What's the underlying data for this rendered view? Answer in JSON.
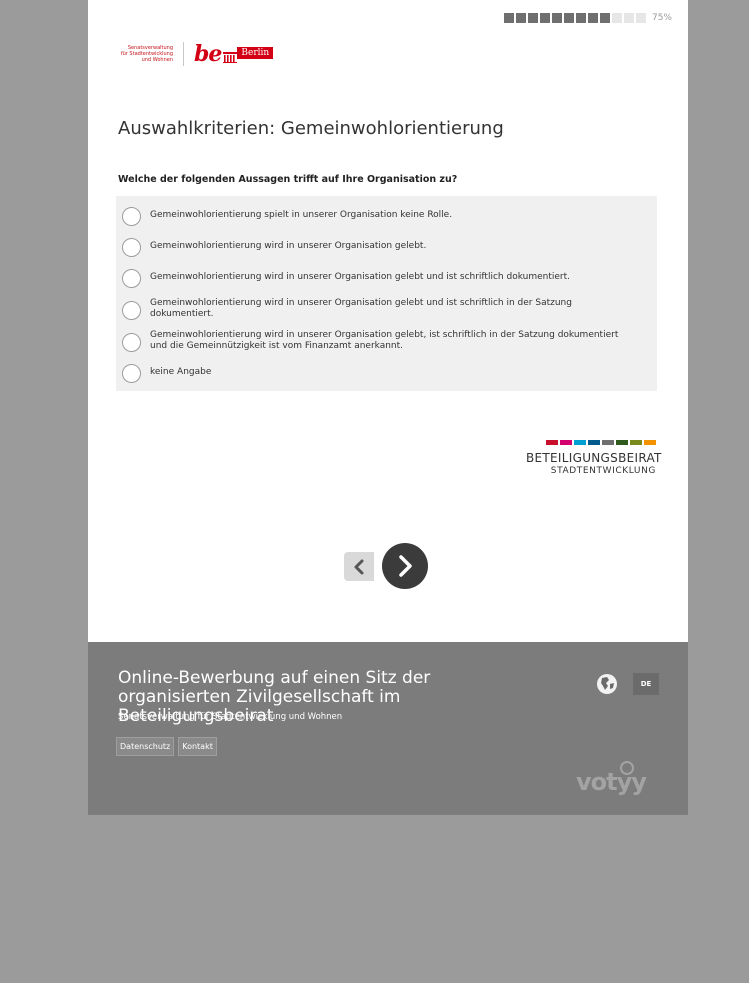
{
  "progress": {
    "text": "75%",
    "filled": 9,
    "total": 12,
    "value_percent": 75
  },
  "header": {
    "senat_text": [
      "Senatsverwaltung",
      "für Stadtentwicklung",
      "und Wohnen"
    ],
    "be_text": "be",
    "berlin_text": "Berlin"
  },
  "page": {
    "title": "Auswahlkriterien: Gemeinwohlorientierung"
  },
  "question": {
    "text": "Welche der folgenden Aussagen trifft auf Ihre Organisation zu?",
    "options": [
      "Gemeinwohlorientierung spielt in unserer Organisation keine Rolle.",
      "Gemeinwohlorientierung wird in unserer Organisation gelebt.",
      "Gemeinwohlorientierung wird in unserer Organisation gelebt und ist schriftlich dokumentiert.",
      "Gemeinwohlorientierung wird in unserer Organisation gelebt und ist schriftlich in der Satzung dokumentiert.",
      "Gemeinwohlorientierung wird in unserer Organisation gelebt, ist schriftlich in der Satzung dokumentiert und die Gemeinnützigkeit ist vom Finanzamt anerkannt.",
      "keine Angabe"
    ]
  },
  "beirat_logo": {
    "title": "BETEILIGUNGSBEIRAT",
    "subtitle": "STADTENTWICKLUNG",
    "bar_colors": [
      "#c8102e",
      "#d4006e",
      "#00a0d2",
      "#005a8c",
      "#6f6f6f",
      "#2e5a1c",
      "#7a8a1a",
      "#f39200"
    ]
  },
  "nav": {
    "prev_icon": "chevron-left-icon",
    "next_icon": "chevron-right-icon"
  },
  "footer": {
    "title": "Online-Bewerbung auf einen Sitz der organisierten Zivilgesellschaft im Beteiligungsbeirat",
    "subtitle": "Senatsverwaltung für Stadtentwicklung und Wohnen",
    "links": [
      "Datenschutz",
      "Kontakt"
    ],
    "language": "DE",
    "globe_icon": "globe-icon",
    "brand": "votyy"
  },
  "colors": {
    "background": "#9b9b9b",
    "footer": "#7c7c7c",
    "brand_red": "#d30015",
    "next_button": "#3b3b3b"
  }
}
